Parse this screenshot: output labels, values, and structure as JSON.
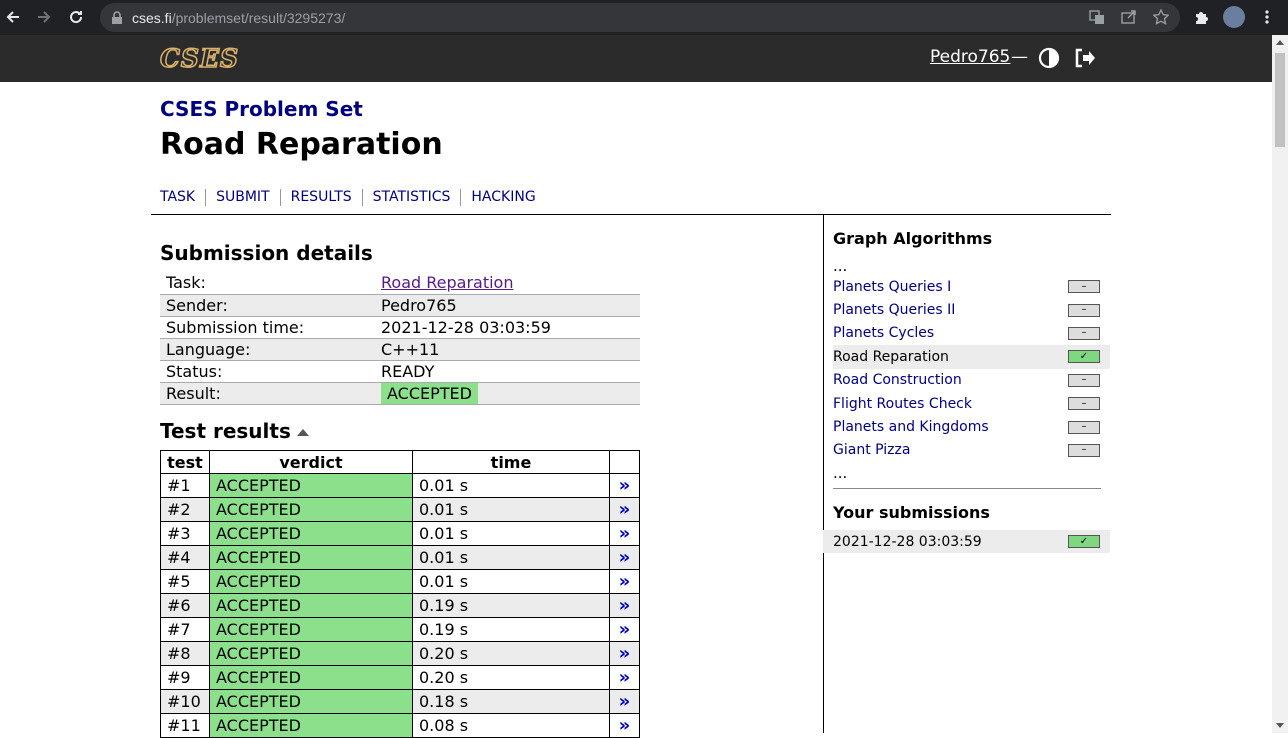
{
  "browser": {
    "url_host": "cses.fi",
    "url_path": "/problemset/result/3295273/"
  },
  "header": {
    "logo": "CSES",
    "username": "Pedro765",
    "dash": "—"
  },
  "page": {
    "subtitle": "CSES Problem Set",
    "title": "Road Reparation",
    "tabs": [
      "TASK",
      "SUBMIT",
      "RESULTS",
      "STATISTICS",
      "HACKING"
    ]
  },
  "details": {
    "heading": "Submission details",
    "rows": [
      {
        "label": "Task:",
        "value": "Road Reparation"
      },
      {
        "label": "Sender:",
        "value": "Pedro765"
      },
      {
        "label": "Submission time:",
        "value": "2021-12-28 03:03:59"
      },
      {
        "label": "Language:",
        "value": "C++11"
      },
      {
        "label": "Status:",
        "value": "READY"
      },
      {
        "label": "Result:",
        "value": "ACCEPTED"
      }
    ]
  },
  "tests": {
    "heading": "Test results",
    "columns": [
      "test",
      "verdict",
      "time",
      ""
    ],
    "rows": [
      {
        "test": "#1",
        "verdict": "ACCEPTED",
        "time": "0.01 s"
      },
      {
        "test": "#2",
        "verdict": "ACCEPTED",
        "time": "0.01 s"
      },
      {
        "test": "#3",
        "verdict": "ACCEPTED",
        "time": "0.01 s"
      },
      {
        "test": "#4",
        "verdict": "ACCEPTED",
        "time": "0.01 s"
      },
      {
        "test": "#5",
        "verdict": "ACCEPTED",
        "time": "0.01 s"
      },
      {
        "test": "#6",
        "verdict": "ACCEPTED",
        "time": "0.19 s"
      },
      {
        "test": "#7",
        "verdict": "ACCEPTED",
        "time": "0.19 s"
      },
      {
        "test": "#8",
        "verdict": "ACCEPTED",
        "time": "0.20 s"
      },
      {
        "test": "#9",
        "verdict": "ACCEPTED",
        "time": "0.20 s"
      },
      {
        "test": "#10",
        "verdict": "ACCEPTED",
        "time": "0.18 s"
      },
      {
        "test": "#11",
        "verdict": "ACCEPTED",
        "time": "0.08 s"
      }
    ],
    "link_glyph": "»"
  },
  "sidebar": {
    "heading": "Graph Algorithms",
    "ellipsis": "...",
    "items": [
      {
        "label": "Planets Queries I",
        "status": "–",
        "ok": false,
        "current": false
      },
      {
        "label": "Planets Queries II",
        "status": "–",
        "ok": false,
        "current": false
      },
      {
        "label": "Planets Cycles",
        "status": "–",
        "ok": false,
        "current": false
      },
      {
        "label": "Road Reparation",
        "status": "✓",
        "ok": true,
        "current": true
      },
      {
        "label": "Road Construction",
        "status": "–",
        "ok": false,
        "current": false
      },
      {
        "label": "Flight Routes Check",
        "status": "–",
        "ok": false,
        "current": false
      },
      {
        "label": "Planets and Kingdoms",
        "status": "–",
        "ok": false,
        "current": false
      },
      {
        "label": "Giant Pizza",
        "status": "–",
        "ok": false,
        "current": false
      }
    ],
    "submissions_heading": "Your submissions",
    "submissions": [
      {
        "time": "2021-12-28 03:03:59",
        "status": "✓"
      }
    ]
  },
  "colors": {
    "accepted": "#8ce08c",
    "link": "#000080",
    "header_bg": "#2b2b2b"
  }
}
